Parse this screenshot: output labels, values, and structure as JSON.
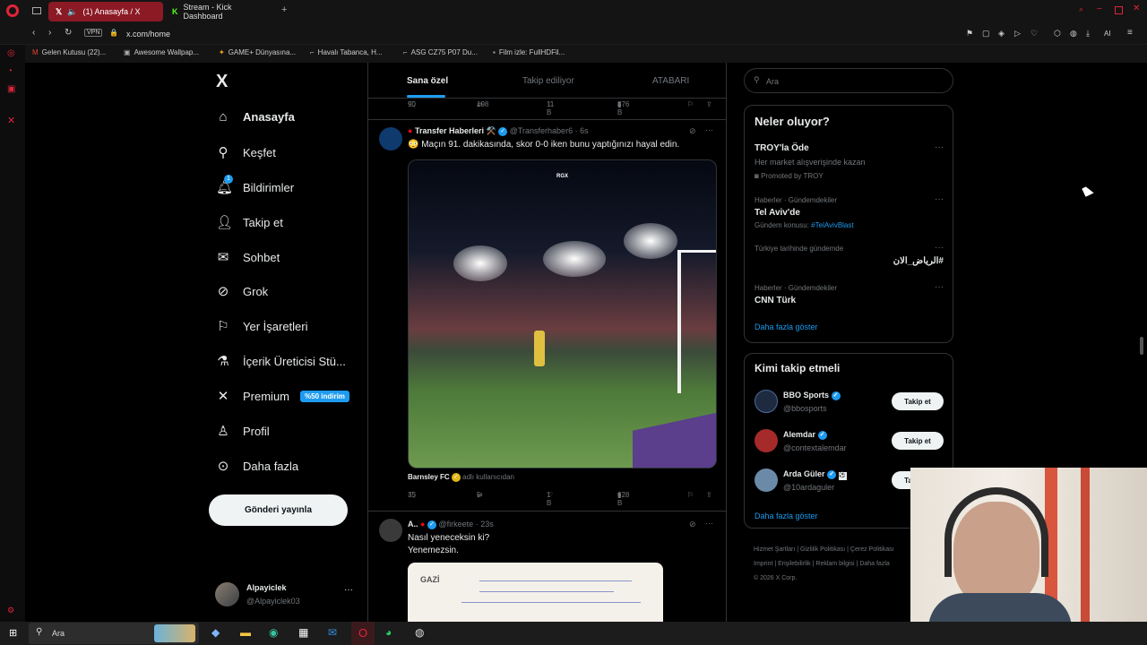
{
  "browser": {
    "tabs": [
      {
        "label": "(1) Anasayfa / X"
      },
      {
        "label": "Stream - Kick Dashboard"
      }
    ],
    "vpn": "VPN",
    "url": "x.com/home",
    "bookmarks": [
      "Gelen Kutusu (22)...",
      "Awesome Wallpap...",
      "GAME+ Dünyasına...",
      "Havalı Tabanca, H...",
      "ASG CZ75 P07 Du...",
      "Film izle: FullHDFil..."
    ],
    "ai_label": "AI"
  },
  "nav": {
    "logo": "X",
    "items": [
      {
        "label": "Anasayfa",
        "icon": "home-icon"
      },
      {
        "label": "Keşfet",
        "icon": "search-icon"
      },
      {
        "label": "Bildirimler",
        "icon": "bell-icon",
        "badge": "1"
      },
      {
        "label": "Takip et",
        "icon": "follow-icon"
      },
      {
        "label": "Sohbet",
        "icon": "mail-icon"
      },
      {
        "label": "Grok",
        "icon": "grok-icon"
      },
      {
        "label": "Yer İşaretleri",
        "icon": "bookmark-icon"
      },
      {
        "label": "İçerik Üreticisi Stü...",
        "icon": "flask-icon"
      },
      {
        "label": "Premium",
        "icon": "x-icon",
        "badge": "%50 indirim"
      },
      {
        "label": "Profil",
        "icon": "person-icon"
      },
      {
        "label": "Daha fazla",
        "icon": "more-icon"
      }
    ],
    "post_button": "Gönderi yayınla",
    "user": {
      "name": "Alpayiclek",
      "handle": "@Alpayiclek03"
    }
  },
  "feed": {
    "tabs": [
      "Sana özel",
      "Takip ediliyor",
      "ATABARI"
    ],
    "prev_stats": {
      "replies": "90",
      "reposts": "198",
      "likes": "11 B",
      "views": "876 B"
    },
    "tweet1": {
      "name": "Transfer Haberleri ⚒️",
      "handle": "@Transferhaber6",
      "time": "6s",
      "text": "😳 Maçın 91. dakikasında, skor 0-0 iken bunu yaptığınızı hayal edin.",
      "watermark": "RGX",
      "source": "Barnsley FC",
      "source_note": "adlı kullanıcıdan",
      "replies": "35",
      "reposts": "5",
      "likes": "1 B",
      "views": "628 B"
    },
    "tweet2": {
      "name": "A..",
      "handle": "@firkeete",
      "time": "23s",
      "line1": "Nasıl yeneceksin ki?",
      "line2": "Yenemezsin.",
      "note_text": "GAZİ"
    }
  },
  "right": {
    "search_placeholder": "Ara",
    "trends_title": "Neler oluyor?",
    "trends": [
      {
        "title": "TROY'la Öde",
        "sub": "Her market alışverişinde kazan",
        "promo": "Promoted by TROY"
      },
      {
        "meta": "Haberler · Gündemdekiler",
        "title": "Tel Aviv'de",
        "sub": "Gündem konusu:",
        "tag": "#TelAvivBlast"
      },
      {
        "meta": "Türkiye tarihinde gündemde",
        "title": "#الرياض_الان"
      },
      {
        "meta": "Haberler · Gündemdekiler",
        "title": "CNN Türk"
      }
    ],
    "trends_more": "Daha fazla göster",
    "who_title": "Kimi takip etmeli",
    "who": [
      {
        "name": "BBO Sports",
        "handle": "@bbosports",
        "btn": "Takip et"
      },
      {
        "name": "Alemdar",
        "handle": "@contextalemdar",
        "btn": "Takip et"
      },
      {
        "name": "Arda Güler",
        "handle": "@10ardaguler",
        "btn": "Takip et"
      }
    ],
    "who_more": "Daha fazla göster",
    "footer": [
      "Hizmet Şartları",
      "Gizlilik Politikası",
      "Çerez Politikası",
      "Imprint",
      "Erişilebilirlik",
      "Reklam bilgisi",
      "Daha fazla",
      "© 2026 X Corp."
    ]
  },
  "taskbar": {
    "search": "Ara"
  }
}
